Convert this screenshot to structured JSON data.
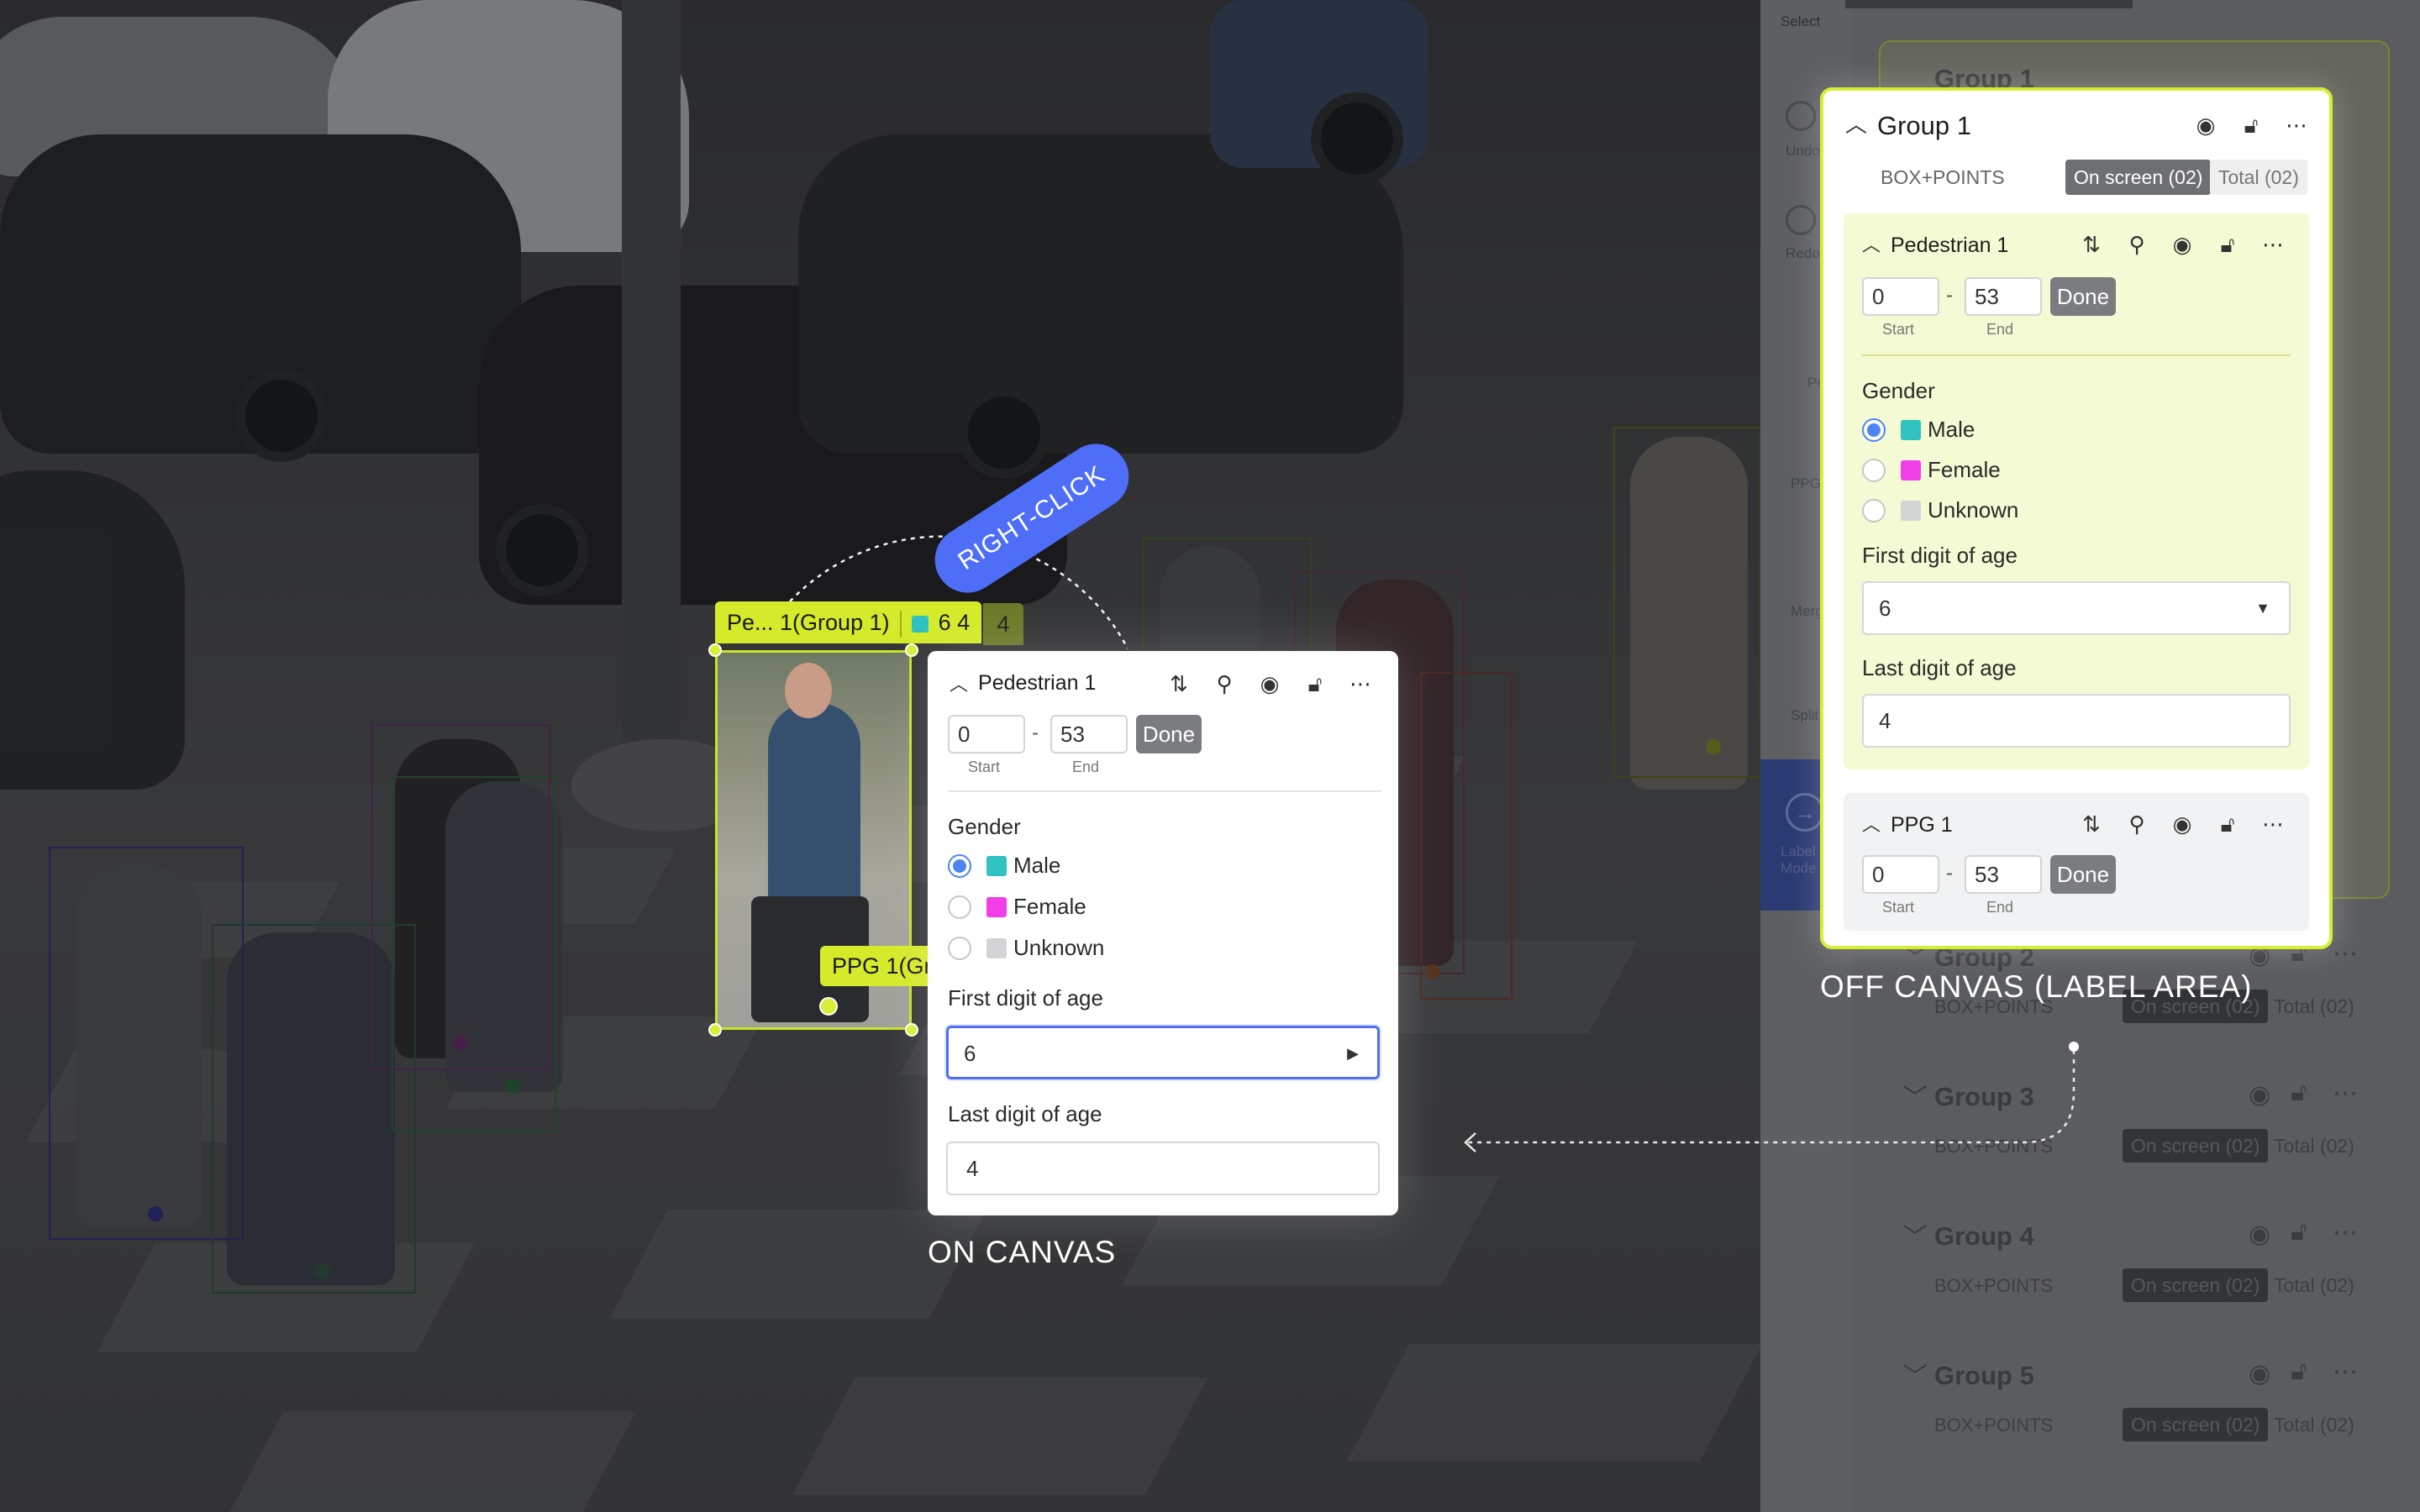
{
  "canvas": {
    "tag_main": {
      "name": "Pe... 1(Group 1)",
      "values": "6 4",
      "ghost": "4"
    },
    "tag_ppg": "PPG 1(Gr",
    "right_click": "RIGHT-CLICK",
    "on_canvas_caption": "ON CANVAS",
    "off_canvas_caption": "OFF CANVAS (LABEL AREA)"
  },
  "canvas_popup": {
    "title": "Pedestrian 1",
    "start": "0",
    "end": "53",
    "start_label": "Start",
    "end_label": "End",
    "done": "Done",
    "gender_label": "Gender",
    "options": [
      {
        "label": "Male",
        "color": "#2fc2c0",
        "selected": true
      },
      {
        "label": "Female",
        "color": "#f23ee8",
        "selected": false
      },
      {
        "label": "Unknown",
        "color": "#d3d4d6",
        "selected": false
      }
    ],
    "first_digit_label": "First digit of age",
    "first_digit_value": "6",
    "last_digit_label": "Last digit of age",
    "last_digit_value": "4"
  },
  "toolbar": {
    "select": "Select",
    "undo": "Undo",
    "redo": "Redo",
    "pedestrian": "Pedestr",
    "ppg": "PPG",
    "merge": "Merg",
    "split": "Split",
    "label_mode": "Label Mode"
  },
  "group_card": {
    "title": "Group 1",
    "type": "BOX+POINTS",
    "on_screen": "On screen (02)",
    "total": "Total (02)",
    "pedestrian": {
      "title": "Pedestrian 1",
      "start": "0",
      "end": "53",
      "start_label": "Start",
      "end_label": "End",
      "done": "Done",
      "gender_label": "Gender",
      "options": [
        {
          "label": "Male",
          "color": "#2fc2c0",
          "selected": true
        },
        {
          "label": "Female",
          "color": "#f23ee8",
          "selected": false
        },
        {
          "label": "Unknown",
          "color": "#d3d4d6",
          "selected": false
        }
      ],
      "first_digit_label": "First digit of age",
      "first_digit_value": "6",
      "last_digit_label": "Last digit of age",
      "last_digit_value": "4"
    },
    "ppg": {
      "title": "PPG 1",
      "start": "0",
      "end": "53",
      "start_label": "Start",
      "end_label": "End",
      "done": "Done"
    }
  },
  "background_groups": [
    {
      "title": "Group 1",
      "type": "BOX+POINTS",
      "on_screen": "On screen (02)",
      "total": "Total (02)"
    },
    {
      "title": "Group 2",
      "type": "BOX+POINTS",
      "on_screen": "On screen (02)",
      "total": "Total (02)"
    },
    {
      "title": "Group 3",
      "type": "BOX+POINTS",
      "on_screen": "On screen (02)",
      "total": "Total (02)"
    },
    {
      "title": "Group 4",
      "type": "BOX+POINTS",
      "on_screen": "On screen (02)",
      "total": "Total (02)"
    },
    {
      "title": "Group 5",
      "type": "BOX+POINTS",
      "on_screen": "On screen (02)",
      "total": "Total (02)"
    }
  ],
  "colors": {
    "accent": "#4f6ef7",
    "highlight": "#d6ee32",
    "selected_radio": "#4f84f7"
  }
}
